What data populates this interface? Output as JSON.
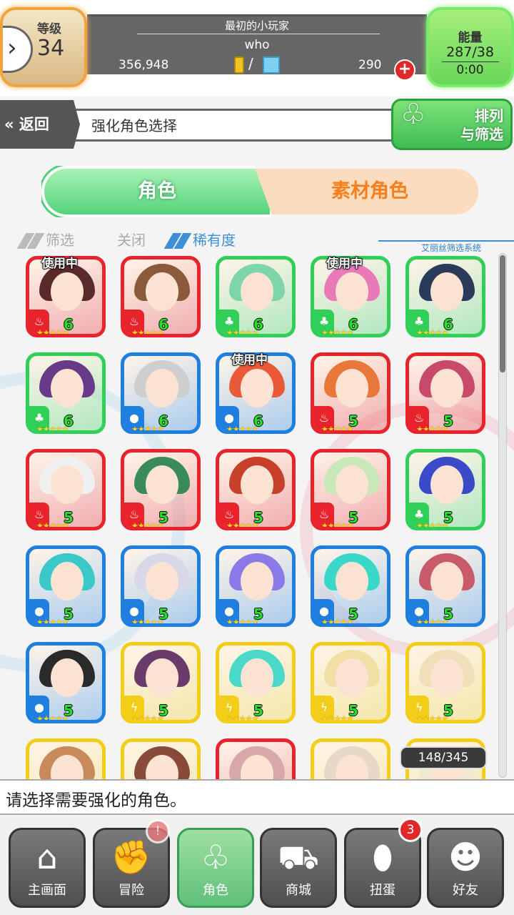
{
  "header": {
    "level_label": "等级",
    "level_value": "34",
    "player_title": "最初的小玩家",
    "player_name": "who",
    "coins": "356,948",
    "currency_slash": "/",
    "gems": "290",
    "plus_symbol": "+",
    "energy_label": "能量",
    "energy_value": "287/38",
    "energy_timer": "0:00"
  },
  "titlebar": {
    "back_label": "返回",
    "page_title": "强化角色选择",
    "sort_label_line1": "排列",
    "sort_label_line2": "与筛选"
  },
  "tabs": {
    "characters": "角色",
    "material": "素材角色"
  },
  "filters": {
    "filter_label": "筛选",
    "off_label": "关闭",
    "rarity_label": "稀有度",
    "system_label": "艾丽丝筛选系统"
  },
  "in_use_label": "使用中",
  "characters": [
    {
      "rank": "6",
      "element": "fire",
      "in_use": true
    },
    {
      "rank": "6",
      "element": "fire",
      "in_use": false
    },
    {
      "rank": "6",
      "element": "wood",
      "in_use": false
    },
    {
      "rank": "6",
      "element": "wood",
      "in_use": true
    },
    {
      "rank": "6",
      "element": "wood",
      "in_use": false
    },
    {
      "rank": "6",
      "element": "wood",
      "in_use": false
    },
    {
      "rank": "6",
      "element": "water",
      "in_use": false
    },
    {
      "rank": "6",
      "element": "water",
      "in_use": true
    },
    {
      "rank": "5",
      "element": "fire",
      "in_use": false
    },
    {
      "rank": "5",
      "element": "fire",
      "in_use": false
    },
    {
      "rank": "5",
      "element": "fire",
      "in_use": false
    },
    {
      "rank": "5",
      "element": "fire",
      "in_use": false
    },
    {
      "rank": "5",
      "element": "fire",
      "in_use": false
    },
    {
      "rank": "5",
      "element": "fire",
      "in_use": false
    },
    {
      "rank": "5",
      "element": "wood",
      "in_use": false
    },
    {
      "rank": "5",
      "element": "water",
      "in_use": false
    },
    {
      "rank": "5",
      "element": "water",
      "in_use": false
    },
    {
      "rank": "5",
      "element": "water",
      "in_use": false
    },
    {
      "rank": "5",
      "element": "water",
      "in_use": false
    },
    {
      "rank": "5",
      "element": "water",
      "in_use": false
    },
    {
      "rank": "5",
      "element": "water",
      "in_use": false
    },
    {
      "rank": "5",
      "element": "thunder",
      "in_use": false
    },
    {
      "rank": "5",
      "element": "thunder",
      "in_use": false
    },
    {
      "rank": "5",
      "element": "thunder",
      "in_use": false
    },
    {
      "rank": "5",
      "element": "thunder",
      "in_use": false
    },
    {
      "rank": "",
      "element": "thunder",
      "in_use": false
    },
    {
      "rank": "",
      "element": "thunder",
      "in_use": false
    },
    {
      "rank": "",
      "element": "fire",
      "in_use": false
    },
    {
      "rank": "",
      "element": "thunder",
      "in_use": false
    },
    {
      "rank": "",
      "element": "thunder",
      "in_use": false
    }
  ],
  "element_colors": {
    "fire": "#e8232b",
    "wood": "#2fcf58",
    "water": "#1e7fe0",
    "thunder": "#f4cd18"
  },
  "stars_text": "★★★★★",
  "character_count": "148/345",
  "message": "请选择需要强化的角色。",
  "nav": {
    "home": "主画面",
    "adventure": "冒险",
    "characters": "角色",
    "shop": "商城",
    "gacha": "扭蛋",
    "gacha_badge": "3",
    "adventure_badge": "!",
    "friends": "好友"
  }
}
